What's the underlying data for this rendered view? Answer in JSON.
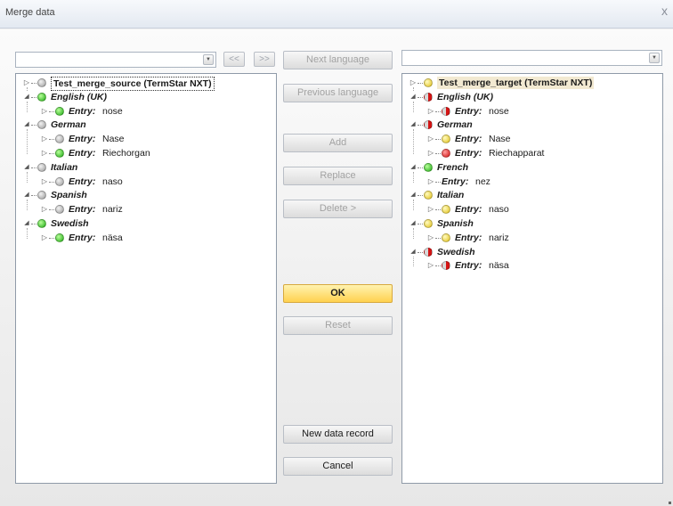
{
  "window": {
    "title": "Merge data",
    "close_glyph": "x"
  },
  "nav": {
    "prev": "<<",
    "next": ">>"
  },
  "source_combo": {
    "value": ""
  },
  "target_combo": {
    "value": ""
  },
  "buttons": {
    "next_language": "Next language",
    "previous_language": "Previous language",
    "add": "Add",
    "replace": "Replace",
    "delete": "Delete >",
    "ok": "OK",
    "reset": "Reset",
    "new_data_record": "New data record",
    "cancel": "Cancel"
  },
  "entry_label": "Entry:",
  "source_tree": {
    "root": "Test_merge_source (TermStar NXT)",
    "languages": [
      {
        "name": "English (UK)",
        "status": "green",
        "entries": [
          {
            "text": "nose",
            "status": "green"
          }
        ]
      },
      {
        "name": "German",
        "status": "grey",
        "entries": [
          {
            "text": "Nase",
            "status": "grey"
          },
          {
            "text": "Riechorgan",
            "status": "green"
          }
        ]
      },
      {
        "name": "Italian",
        "status": "grey",
        "entries": [
          {
            "text": "naso",
            "status": "grey"
          }
        ]
      },
      {
        "name": "Spanish",
        "status": "grey",
        "entries": [
          {
            "text": "nariz",
            "status": "grey"
          }
        ]
      },
      {
        "name": "Swedish",
        "status": "green",
        "entries": [
          {
            "text": "näsa",
            "status": "green"
          }
        ]
      }
    ]
  },
  "target_tree": {
    "root": "Test_merge_target (TermStar NXT)",
    "languages": [
      {
        "name": "English (UK)",
        "status": "halfred",
        "entries": [
          {
            "text": "nose",
            "status": "halfred"
          }
        ]
      },
      {
        "name": "German",
        "status": "halfred",
        "entries": [
          {
            "text": "Nase",
            "status": "yellow"
          },
          {
            "text": "Riechapparat",
            "status": "red"
          }
        ]
      },
      {
        "name": "French",
        "status": "green",
        "entries": [
          {
            "text": "nez",
            "status": null
          }
        ]
      },
      {
        "name": "Italian",
        "status": "yellow",
        "entries": [
          {
            "text": "naso",
            "status": "yellow"
          }
        ]
      },
      {
        "name": "Spanish",
        "status": "yellow",
        "entries": [
          {
            "text": "nariz",
            "status": "yellow"
          }
        ]
      },
      {
        "name": "Swedish",
        "status": "halfred",
        "entries": [
          {
            "text": "näsa",
            "status": "halfred"
          }
        ]
      }
    ]
  }
}
